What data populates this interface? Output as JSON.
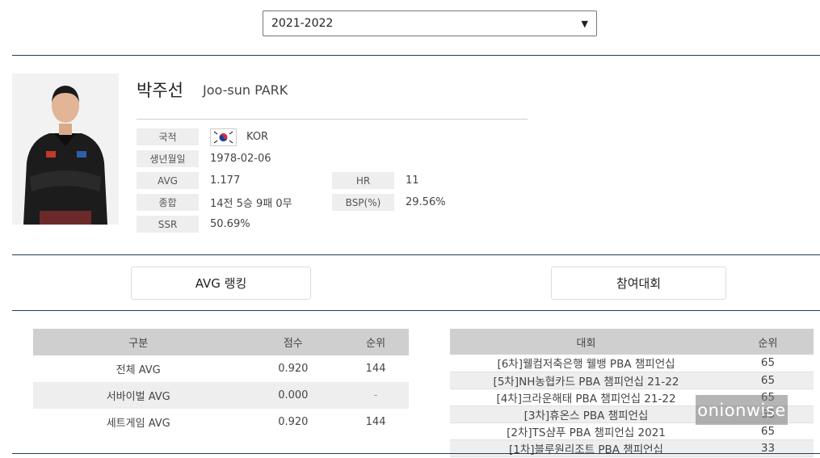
{
  "season": {
    "selected": "2021-2022"
  },
  "player": {
    "name_ko": "박주선",
    "name_en": "Joo-sun PARK",
    "fields": {
      "nationality_label": "국적",
      "nationality_value": "KOR",
      "birth_label": "생년월일",
      "birth_value": "1978-02-06",
      "avg_label": "AVG",
      "avg_value": "1.177",
      "hr_label": "HR",
      "hr_value": "11",
      "record_label": "종합",
      "record_value": "14전 5승 9패 0무",
      "bsp_label": "BSP(%)",
      "bsp_value": "29.56%",
      "ssr_label": "SSR",
      "ssr_value": "50.69%"
    }
  },
  "tabs": {
    "avg_ranking": "AVG 랭킹",
    "tournaments": "참여대회"
  },
  "avg_table": {
    "headers": [
      "구분",
      "점수",
      "순위"
    ],
    "rows": [
      [
        "전체 AVG",
        "0.920",
        "144"
      ],
      [
        "서바이벌 AVG",
        "0.000",
        "-"
      ],
      [
        "세트게임 AVG",
        "0.920",
        "144"
      ]
    ]
  },
  "tournament_table": {
    "headers": [
      "대회",
      "순위"
    ],
    "rows": [
      [
        "[6차]웰컴저축은행 웰뱅 PBA 챔피언십",
        "65"
      ],
      [
        "[5차]NH농협카드 PBA 챔피언십 21-22",
        "65"
      ],
      [
        "[4차]크라운해태 PBA 챔피언십 21-22",
        "65"
      ],
      [
        "[3차]휴온스 PBA 챔피언십",
        "65"
      ],
      [
        "[2차]TS샴푸 PBA 챔피언십 2021",
        "65"
      ],
      [
        "[1차]블루원리조트 PBA 챔피언십",
        "33"
      ]
    ]
  },
  "watermark": "onionwise",
  "colors": {
    "rule": "#1f3e5a",
    "label_bg": "#eeeeee",
    "header_bg": "#cfcfcf",
    "flag_red": "#cd2e3a",
    "flag_blue": "#0047a0"
  }
}
